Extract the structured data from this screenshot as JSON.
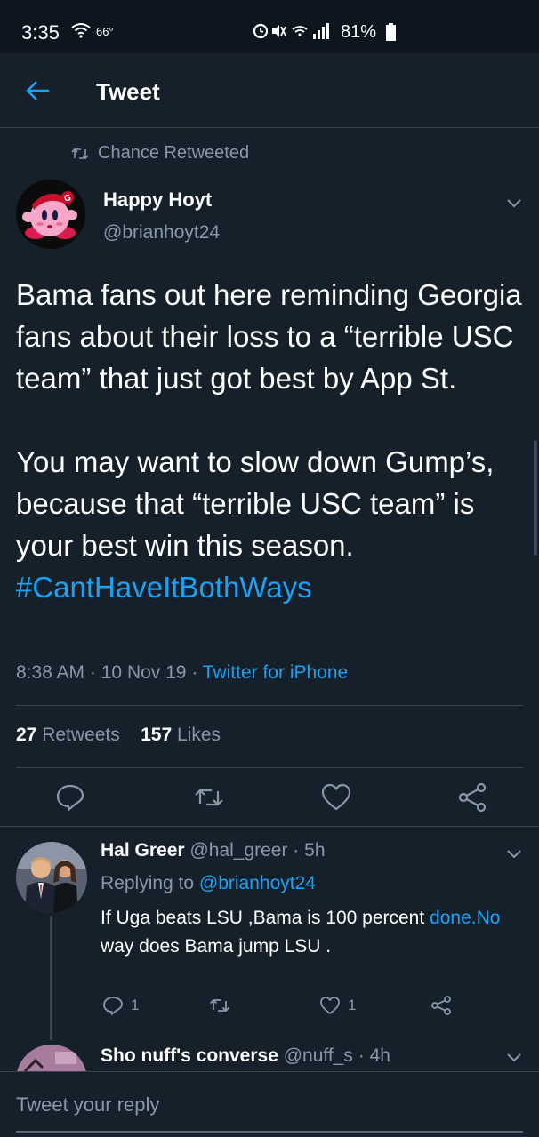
{
  "status_bar": {
    "time": "3:35",
    "temperature": "66°",
    "battery": "81%"
  },
  "header": {
    "title": "Tweet"
  },
  "retweet": {
    "label": "Chance Retweeted"
  },
  "tweet": {
    "author_name": "Happy Hoyt",
    "author_handle": "@brianhoyt24",
    "text_before_hashtag": "Bama fans out here reminding Georgia fans about their loss to a “terrible USC team” that just got best by App St.\n\nYou may want to slow down Gump’s, because that “terrible USC team” is your best win this season. ",
    "hashtag": "#CantHaveItBothWays",
    "time": "8:38 AM",
    "date": "10 Nov 19",
    "source": "Twitter for iPhone",
    "retweets_count": "27",
    "retweets_label": "Retweets",
    "likes_count": "157",
    "likes_label": "Likes"
  },
  "reply": {
    "name": "Hal Greer",
    "handle": "@hal_greer",
    "age": "5h",
    "replying_label": "Replying to",
    "replying_handle": "@brianhoyt24",
    "text_before_link": "If Uga beats LSU ,Bama is 100 percent ",
    "link_text": "done.No",
    "text_after_link": " way does Bama jump LSU .",
    "reply_count": "1",
    "like_count": "1"
  },
  "next_reply": {
    "name": "Sho nuff's converse",
    "handle": "@nuff_s",
    "age": "4h"
  },
  "compose": {
    "placeholder": "Tweet your reply"
  },
  "colors": {
    "background": "#15202b",
    "accent": "#1da1f2",
    "secondary_text": "#8899a6",
    "divider": "#38444d"
  }
}
